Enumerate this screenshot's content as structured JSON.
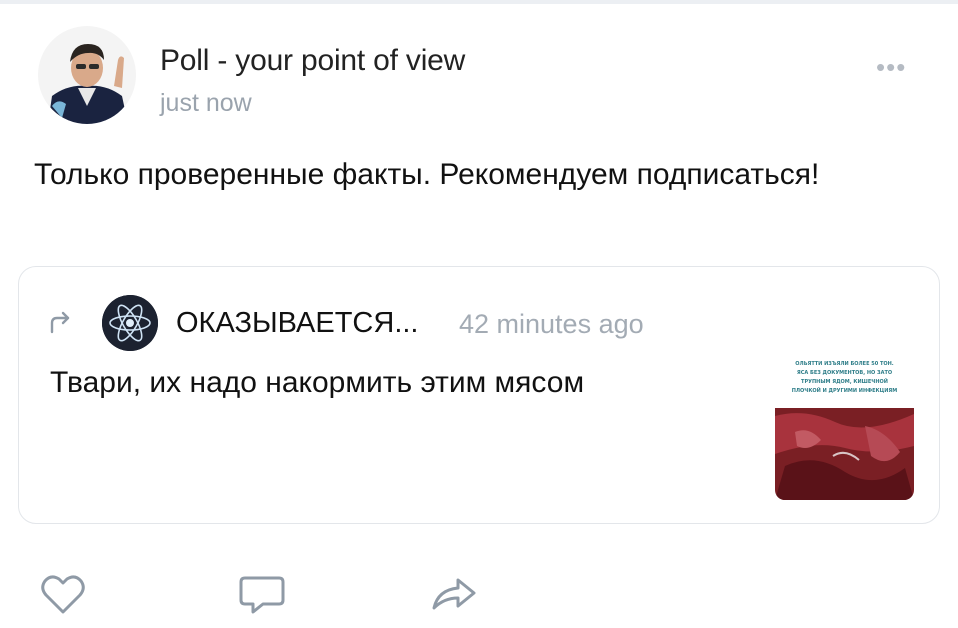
{
  "post": {
    "author": "Poll - your point of view",
    "time": "just now",
    "more_label": "•••",
    "text": "Только проверенные факты. Рекомендуем подписаться!"
  },
  "repost": {
    "source_name": "ОКАЗЫВАЕТСЯ...",
    "time": "42 minutes ago",
    "text": "Твари, их надо накормить этим мясом",
    "thumbnail_caption": [
      "ОЛЬЯТТИ ИЗЪЯЛИ БОЛЕЕ 50 ТОН.",
      "ЯСА БЕЗ ДОКУМЕНТОВ, НО ЗАТО",
      "ТРУПНЫМ ЯДОМ, КИШЕЧНОЙ",
      "ПЛОЧКОЙ И ДРУГИМИ ИНФЕКЦИЯМ"
    ]
  },
  "icons": {
    "like": "heart-icon",
    "comment": "comment-icon",
    "share": "share-icon",
    "repost": "repost-arrow-icon"
  },
  "colors": {
    "muted": "#9aa3ad",
    "icon": "#8f9aa6"
  }
}
